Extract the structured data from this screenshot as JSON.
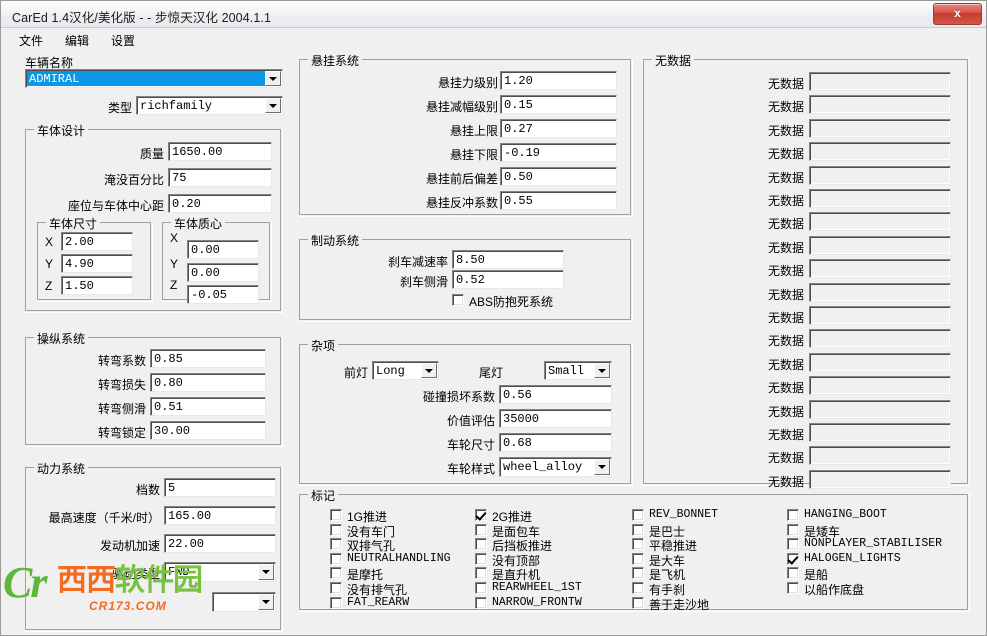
{
  "window": {
    "title": "CarEd 1.4汉化/美化版 -  - 步惊天汉化 2004.1.1",
    "close_label": "x"
  },
  "menubar": {
    "items": [
      {
        "label": "文件"
      },
      {
        "label": "编辑"
      },
      {
        "label": "设置"
      }
    ]
  },
  "vehicle_name": {
    "label": "车辆名称",
    "value": "ADMIRAL",
    "type_label": "类型",
    "type_value": "richfamily"
  },
  "body_design": {
    "title": "车体设计",
    "mass_label": "质量",
    "mass_value": "1650.00",
    "submerge_label": "淹没百分比",
    "submerge_value": "75",
    "seat_label": "座位与车体中心距",
    "seat_value": "0.20",
    "dimensions": {
      "title": "车体尺寸",
      "x_label": "X",
      "x_value": "2.00",
      "y_label": "Y",
      "y_value": "4.90",
      "z_label": "Z",
      "z_value": "1.50"
    },
    "center_of_mass": {
      "title": "车体质心",
      "x_label": "X",
      "x_value": "0.00",
      "y_label": "Y",
      "y_value": "0.00",
      "z_label": "Z",
      "z_value": "-0.05"
    }
  },
  "handling": {
    "title": "操纵系统",
    "rows": [
      {
        "label": "转弯系数",
        "value": "0.85"
      },
      {
        "label": "转弯损失",
        "value": "0.80"
      },
      {
        "label": "转弯侧滑",
        "value": "0.51"
      },
      {
        "label": "转弯锁定",
        "value": "30.00"
      }
    ]
  },
  "powertrain": {
    "title": "动力系统",
    "gears_label": "档数",
    "gears_value": "5",
    "topspeed_label": "最高速度（千米/时）",
    "topspeed_value": "165.00",
    "accel_label": "发动机加速",
    "accel_value": "22.00",
    "drive_label": "驱动类型",
    "drive_value": "FWD",
    "extra_value": ""
  },
  "suspension": {
    "title": "悬挂系统",
    "rows": [
      {
        "label": "悬挂力级别",
        "value": "1.20"
      },
      {
        "label": "悬挂减幅级别",
        "value": "0.15"
      },
      {
        "label": "悬挂上限",
        "value": "0.27"
      },
      {
        "label": "悬挂下限",
        "value": "-0.19"
      },
      {
        "label": "悬挂前后偏差",
        "value": "0.50"
      },
      {
        "label": "悬挂反冲系数",
        "value": "0.55"
      }
    ]
  },
  "braking": {
    "title": "制动系统",
    "decel_label": "刹车减速率",
    "decel_value": "8.50",
    "bias_label": "刹车侧滑",
    "bias_value": "0.52",
    "abs_label": "ABS防抱死系统",
    "abs_checked": false
  },
  "misc": {
    "title": "杂项",
    "front_light_label": "前灯",
    "front_light_value": "Long",
    "rear_light_label": "尾灯",
    "rear_light_value": "Small",
    "damage_label": "碰撞损坏系数",
    "damage_value": "0.56",
    "value_label": "价值评估",
    "value_value": "35000",
    "wheel_size_label": "车轮尺寸",
    "wheel_size_value": "0.68",
    "wheel_style_label": "车轮样式",
    "wheel_style_value": "wheel_alloy"
  },
  "nodata": {
    "title": "无数据",
    "rows": [
      {
        "label": "无数据",
        "value": ""
      },
      {
        "label": "无数据",
        "value": ""
      },
      {
        "label": "无数据",
        "value": ""
      },
      {
        "label": "无数据",
        "value": ""
      },
      {
        "label": "无数据",
        "value": ""
      },
      {
        "label": "无数据",
        "value": ""
      },
      {
        "label": "无数据",
        "value": ""
      },
      {
        "label": "无数据",
        "value": ""
      },
      {
        "label": "无数据",
        "value": ""
      },
      {
        "label": "无数据",
        "value": ""
      },
      {
        "label": "无数据",
        "value": ""
      },
      {
        "label": "无数据",
        "value": ""
      },
      {
        "label": "无数据",
        "value": ""
      },
      {
        "label": "无数据",
        "value": ""
      },
      {
        "label": "无数据",
        "value": ""
      },
      {
        "label": "无数据",
        "value": ""
      },
      {
        "label": "无数据",
        "value": ""
      },
      {
        "label": "无数据",
        "value": ""
      }
    ]
  },
  "flags": {
    "title": "标记",
    "columns": [
      {
        "items": [
          {
            "label": "1G推进",
            "checked": false,
            "mono": false
          },
          {
            "label": "没有车门",
            "checked": false,
            "mono": false
          },
          {
            "label": "双排气孔",
            "checked": false,
            "mono": false
          },
          {
            "label": "NEUTRALHANDLING",
            "checked": false,
            "mono": true
          },
          {
            "label": "是摩托",
            "checked": false,
            "mono": false
          },
          {
            "label": "没有排气孔",
            "checked": false,
            "mono": false
          },
          {
            "label": "FAT_REARW",
            "checked": false,
            "mono": true
          }
        ]
      },
      {
        "items": [
          {
            "label": "2G推进",
            "checked": true,
            "mono": false
          },
          {
            "label": "是面包车",
            "checked": false,
            "mono": false
          },
          {
            "label": "后挡板推进",
            "checked": false,
            "mono": false
          },
          {
            "label": "没有顶部",
            "checked": false,
            "mono": false
          },
          {
            "label": "是直升机",
            "checked": false,
            "mono": false
          },
          {
            "label": "REARWHEEL_1ST",
            "checked": false,
            "mono": true
          },
          {
            "label": "NARROW_FRONTW",
            "checked": false,
            "mono": true
          }
        ]
      },
      {
        "items": [
          {
            "label": "REV_BONNET",
            "checked": false,
            "mono": true
          },
          {
            "label": "是巴士",
            "checked": false,
            "mono": false
          },
          {
            "label": "平稳推进",
            "checked": false,
            "mono": false
          },
          {
            "label": "是大车",
            "checked": false,
            "mono": false
          },
          {
            "label": "是飞机",
            "checked": false,
            "mono": false
          },
          {
            "label": "有手刹",
            "checked": false,
            "mono": false
          },
          {
            "label": "善于走沙地",
            "checked": false,
            "mono": false
          }
        ]
      },
      {
        "items": [
          {
            "label": "HANGING_BOOT",
            "checked": false,
            "mono": true
          },
          {
            "label": "是矮车",
            "checked": false,
            "mono": false
          },
          {
            "label": "NONPLAYER_STABILISER",
            "checked": false,
            "mono": true
          },
          {
            "label": "HALOGEN_LIGHTS",
            "checked": true,
            "mono": true
          },
          {
            "label": "是船",
            "checked": false,
            "mono": false
          },
          {
            "label": "以船作底盘",
            "checked": false,
            "mono": false
          }
        ]
      }
    ]
  },
  "watermark": {
    "logo": "Cr",
    "site_cn_1": "西西",
    "site_cn_2": "软件园",
    "domain": "CR173.COM"
  },
  "colors": {
    "face": "#f0f0f0",
    "selection": "#0a97e8",
    "close_button": "#c33d30",
    "watermark_orange": "#f36b21",
    "watermark_green": "#5fb63a"
  }
}
